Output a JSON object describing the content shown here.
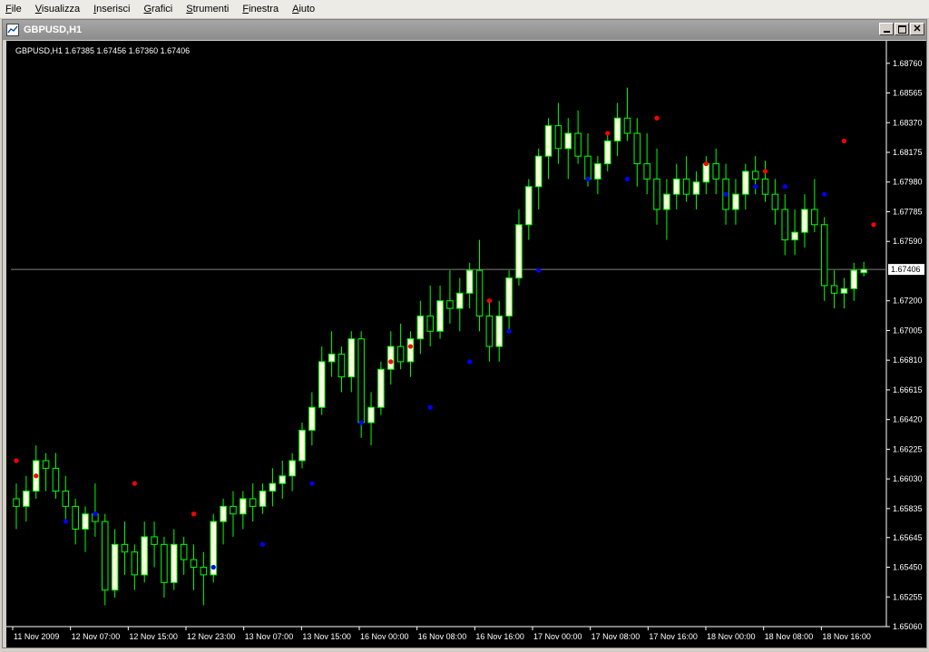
{
  "menu": [
    {
      "key": "F",
      "rest": "ile"
    },
    {
      "key": "V",
      "rest": "isualizza"
    },
    {
      "key": "I",
      "rest": "nserisci"
    },
    {
      "key": "G",
      "rest": "rafici"
    },
    {
      "key": "S",
      "rest": "trumenti"
    },
    {
      "key": "F",
      "rest": "inestra"
    },
    {
      "key": "A",
      "rest": "iuto"
    }
  ],
  "window": {
    "title": "GBPUSD,H1",
    "minimize_icon": "minimize-icon",
    "restore_icon": "restore-icon",
    "close_icon": "close-icon"
  },
  "chart": {
    "info_label": "GBPUSD,H1  1.67385 1.67456 1.67360 1.67406",
    "current_price_label": "1.67406",
    "colors": {
      "background": "#000000",
      "bull_body": "#ffffe0",
      "wick": "#00ff00",
      "sar_below": "#0000ff",
      "sar_above": "#ff0000",
      "price_line": "#808080"
    }
  },
  "chart_data": {
    "type": "candlestick",
    "symbol": "GBPUSD",
    "timeframe": "H1",
    "ylim": [
      1.6506,
      1.6886
    ],
    "y_ticks": [
      "1.68760",
      "1.68565",
      "1.68370",
      "1.68175",
      "1.67980",
      "1.67785",
      "1.67590",
      "1.67406",
      "1.67200",
      "1.67005",
      "1.66810",
      "1.66615",
      "1.66420",
      "1.66225",
      "1.66030",
      "1.65835",
      "1.65645",
      "1.65450",
      "1.65255",
      "1.65060"
    ],
    "x_ticks": [
      "11 Nov 2009",
      "12 Nov 07:00",
      "12 Nov 15:00",
      "12 Nov 23:00",
      "13 Nov 07:00",
      "13 Nov 15:00",
      "16 Nov 00:00",
      "16 Nov 08:00",
      "16 Nov 16:00",
      "17 Nov 00:00",
      "17 Nov 08:00",
      "17 Nov 16:00",
      "18 Nov 00:00",
      "18 Nov 08:00",
      "18 Nov 16:00"
    ],
    "current_price": 1.67406,
    "last_bar": {
      "open": 1.67385,
      "high": 1.67456,
      "low": 1.6736,
      "close": 1.67406
    },
    "candles": [
      [
        1.659,
        1.66,
        1.657,
        1.6585
      ],
      [
        1.6585,
        1.6605,
        1.6575,
        1.6595
      ],
      [
        1.6595,
        1.6625,
        1.659,
        1.6615
      ],
      [
        1.6615,
        1.662,
        1.6595,
        1.661
      ],
      [
        1.661,
        1.662,
        1.659,
        1.6595
      ],
      [
        1.6595,
        1.6605,
        1.6575,
        1.6585
      ],
      [
        1.6585,
        1.659,
        1.656,
        1.657
      ],
      [
        1.657,
        1.6585,
        1.6555,
        1.658
      ],
      [
        1.658,
        1.66,
        1.6565,
        1.6575
      ],
      [
        1.6575,
        1.658,
        1.652,
        1.653
      ],
      [
        1.653,
        1.657,
        1.6525,
        1.656
      ],
      [
        1.656,
        1.6575,
        1.654,
        1.6555
      ],
      [
        1.6555,
        1.656,
        1.653,
        1.654
      ],
      [
        1.654,
        1.6575,
        1.6535,
        1.6565
      ],
      [
        1.6565,
        1.6575,
        1.6545,
        1.656
      ],
      [
        1.656,
        1.6565,
        1.6525,
        1.6535
      ],
      [
        1.6535,
        1.657,
        1.653,
        1.656
      ],
      [
        1.656,
        1.6565,
        1.654,
        1.655
      ],
      [
        1.655,
        1.656,
        1.653,
        1.6545
      ],
      [
        1.6545,
        1.6555,
        1.652,
        1.654
      ],
      [
        1.654,
        1.658,
        1.6535,
        1.6575
      ],
      [
        1.6575,
        1.659,
        1.656,
        1.6585
      ],
      [
        1.6585,
        1.6595,
        1.6565,
        1.658
      ],
      [
        1.658,
        1.6595,
        1.657,
        1.659
      ],
      [
        1.659,
        1.66,
        1.6575,
        1.6585
      ],
      [
        1.6585,
        1.66,
        1.658,
        1.6595
      ],
      [
        1.6595,
        1.661,
        1.6585,
        1.66
      ],
      [
        1.66,
        1.6615,
        1.659,
        1.6605
      ],
      [
        1.6605,
        1.662,
        1.6595,
        1.6615
      ],
      [
        1.6615,
        1.664,
        1.661,
        1.6635
      ],
      [
        1.6635,
        1.666,
        1.6625,
        1.665
      ],
      [
        1.665,
        1.669,
        1.6645,
        1.668
      ],
      [
        1.668,
        1.67,
        1.667,
        1.6685
      ],
      [
        1.6685,
        1.669,
        1.666,
        1.667
      ],
      [
        1.667,
        1.67,
        1.666,
        1.6695
      ],
      [
        1.6695,
        1.67,
        1.663,
        1.664
      ],
      [
        1.664,
        1.666,
        1.6625,
        1.665
      ],
      [
        1.665,
        1.668,
        1.6645,
        1.6675
      ],
      [
        1.6675,
        1.67,
        1.6665,
        1.669
      ],
      [
        1.669,
        1.6705,
        1.6675,
        1.668
      ],
      [
        1.668,
        1.67,
        1.667,
        1.6695
      ],
      [
        1.6695,
        1.672,
        1.6685,
        1.671
      ],
      [
        1.671,
        1.673,
        1.669,
        1.67
      ],
      [
        1.67,
        1.673,
        1.6695,
        1.672
      ],
      [
        1.672,
        1.674,
        1.6705,
        1.6715
      ],
      [
        1.6715,
        1.6735,
        1.67,
        1.6725
      ],
      [
        1.6725,
        1.6745,
        1.6715,
        1.674
      ],
      [
        1.674,
        1.676,
        1.67,
        1.671
      ],
      [
        1.671,
        1.672,
        1.668,
        1.669
      ],
      [
        1.669,
        1.672,
        1.668,
        1.671
      ],
      [
        1.671,
        1.674,
        1.67,
        1.6735
      ],
      [
        1.6735,
        1.678,
        1.673,
        1.677
      ],
      [
        1.677,
        1.68,
        1.676,
        1.6795
      ],
      [
        1.6795,
        1.682,
        1.678,
        1.6815
      ],
      [
        1.6815,
        1.684,
        1.68,
        1.6835
      ],
      [
        1.6835,
        1.685,
        1.681,
        1.682
      ],
      [
        1.682,
        1.684,
        1.68,
        1.683
      ],
      [
        1.683,
        1.6845,
        1.681,
        1.6815
      ],
      [
        1.6815,
        1.683,
        1.6795,
        1.68
      ],
      [
        1.68,
        1.6815,
        1.679,
        1.681
      ],
      [
        1.681,
        1.683,
        1.6805,
        1.6825
      ],
      [
        1.6825,
        1.685,
        1.6815,
        1.684
      ],
      [
        1.684,
        1.686,
        1.6825,
        1.683
      ],
      [
        1.683,
        1.684,
        1.6795,
        1.681
      ],
      [
        1.681,
        1.683,
        1.679,
        1.68
      ],
      [
        1.68,
        1.682,
        1.677,
        1.678
      ],
      [
        1.678,
        1.68,
        1.676,
        1.679
      ],
      [
        1.679,
        1.681,
        1.678,
        1.68
      ],
      [
        1.68,
        1.6815,
        1.6785,
        1.679
      ],
      [
        1.679,
        1.6805,
        1.678,
        1.6798
      ],
      [
        1.6798,
        1.6815,
        1.679,
        1.681
      ],
      [
        1.681,
        1.682,
        1.679,
        1.68
      ],
      [
        1.68,
        1.681,
        1.677,
        1.678
      ],
      [
        1.678,
        1.68,
        1.677,
        1.679
      ],
      [
        1.679,
        1.681,
        1.678,
        1.6805
      ],
      [
        1.6805,
        1.6815,
        1.679,
        1.68
      ],
      [
        1.68,
        1.6812,
        1.6785,
        1.679
      ],
      [
        1.679,
        1.68,
        1.677,
        1.678
      ],
      [
        1.678,
        1.679,
        1.675,
        1.676
      ],
      [
        1.676,
        1.678,
        1.675,
        1.6765
      ],
      [
        1.6765,
        1.679,
        1.6755,
        1.678
      ],
      [
        1.678,
        1.68,
        1.6765,
        1.677
      ],
      [
        1.677,
        1.6775,
        1.672,
        1.673
      ],
      [
        1.673,
        1.674,
        1.6715,
        1.6725
      ],
      [
        1.6725,
        1.6735,
        1.6715,
        1.6728
      ],
      [
        1.6728,
        1.6745,
        1.672,
        1.674
      ],
      [
        1.67385,
        1.67456,
        1.6736,
        1.67406
      ]
    ],
    "sar": [
      [
        0,
        1.6615,
        "above"
      ],
      [
        2,
        1.6605,
        "above"
      ],
      [
        5,
        1.6575,
        "below"
      ],
      [
        8,
        1.658,
        "below"
      ],
      [
        12,
        1.66,
        "above"
      ],
      [
        18,
        1.658,
        "above"
      ],
      [
        20,
        1.6545,
        "below"
      ],
      [
        25,
        1.656,
        "below"
      ],
      [
        30,
        1.66,
        "below"
      ],
      [
        35,
        1.664,
        "below"
      ],
      [
        38,
        1.668,
        "above"
      ],
      [
        40,
        1.669,
        "above"
      ],
      [
        42,
        1.665,
        "below"
      ],
      [
        46,
        1.668,
        "below"
      ],
      [
        48,
        1.672,
        "above"
      ],
      [
        50,
        1.67,
        "below"
      ],
      [
        53,
        1.674,
        "below"
      ],
      [
        58,
        1.68,
        "below"
      ],
      [
        60,
        1.683,
        "above"
      ],
      [
        62,
        1.68,
        "below"
      ],
      [
        65,
        1.684,
        "above"
      ],
      [
        70,
        1.681,
        "above"
      ],
      [
        72,
        1.679,
        "below"
      ],
      [
        75,
        1.6795,
        "below"
      ],
      [
        76,
        1.6805,
        "above"
      ],
      [
        78,
        1.6795,
        "below"
      ],
      [
        82,
        1.679,
        "below"
      ],
      [
        84,
        1.6825,
        "above"
      ],
      [
        87,
        1.677,
        "above"
      ]
    ]
  }
}
